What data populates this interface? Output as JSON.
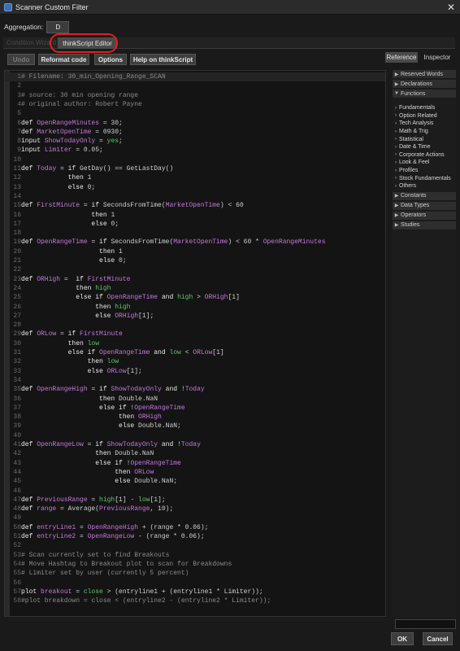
{
  "window": {
    "title": "Scanner Custom Filter",
    "close_glyph": "✕"
  },
  "aggregation": {
    "label": "Aggregation:",
    "value": "D"
  },
  "tabs": {
    "condition_wizard": "Condition Wizard",
    "thinkscript_editor": "thinkScript Editor"
  },
  "toolbar": {
    "undo": "Undo",
    "reformat": "Reformat code",
    "options": "Options",
    "help": "Help on thinkScript"
  },
  "side_tabs": {
    "reference": "Reference",
    "inspector": "Inspector"
  },
  "reference": {
    "sections_top": [
      {
        "label": "Reserved Words",
        "chev": "▶"
      },
      {
        "label": "Declarations",
        "chev": "▶"
      },
      {
        "label": "Functions",
        "chev": "▼"
      }
    ],
    "functions": [
      "Fundamentals",
      "Option Related",
      "Tech Analysis",
      "Math & Trig",
      "Statistical",
      "Date & Time",
      "Corporate Actions",
      "Look & Feel",
      "Profiles",
      "Stock Fundamentals",
      "Others"
    ],
    "sections_bottom": [
      "Constants",
      "Data Types",
      "Operators",
      "Studies"
    ]
  },
  "colors": {
    "keyword": "#e8e8e8",
    "identifier": "#c678dd",
    "number": "#d0d0d0",
    "comment": "#8a8a8a",
    "constant": "#5ec76a",
    "literal": "#5ec76a"
  },
  "code_lines": [
    [
      [
        "c",
        "# Filename: 30_min_Opening_Range_SCAN"
      ]
    ],
    [],
    [
      [
        "c",
        "# source: 30 min opening range"
      ]
    ],
    [
      [
        "c",
        "# original author: Robert Payne"
      ]
    ],
    [],
    [
      [
        "k",
        "def "
      ],
      [
        "v",
        "OpenRangeMinutes"
      ],
      [
        "p",
        " = 30;"
      ]
    ],
    [
      [
        "k",
        "def "
      ],
      [
        "v",
        "MarketOpenTime"
      ],
      [
        "p",
        " = 0930;"
      ]
    ],
    [
      [
        "k",
        "input "
      ],
      [
        "v",
        "ShowTodayOnly"
      ],
      [
        "p",
        " = "
      ],
      [
        "g",
        "yes"
      ],
      [
        "p",
        ";"
      ]
    ],
    [
      [
        "k",
        "input "
      ],
      [
        "v",
        "Limiter"
      ],
      [
        "p",
        " = 0.05;"
      ]
    ],
    [],
    [
      [
        "k",
        "def "
      ],
      [
        "v",
        "Today"
      ],
      [
        "p",
        " = "
      ],
      [
        "k",
        "if "
      ],
      [
        "p",
        "GetDay() == GetLastDay()"
      ]
    ],
    [
      [
        "p",
        "            "
      ],
      [
        "k",
        "then "
      ],
      [
        "p",
        "1"
      ]
    ],
    [
      [
        "p",
        "            "
      ],
      [
        "k",
        "else "
      ],
      [
        "p",
        "0;"
      ]
    ],
    [],
    [
      [
        "k",
        "def "
      ],
      [
        "v",
        "FirstMinute"
      ],
      [
        "p",
        " = "
      ],
      [
        "k",
        "if "
      ],
      [
        "p",
        "SecondsFromTime("
      ],
      [
        "v",
        "MarketOpenTime"
      ],
      [
        "p",
        ") < 60"
      ]
    ],
    [
      [
        "p",
        "                  "
      ],
      [
        "k",
        "then "
      ],
      [
        "p",
        "1"
      ]
    ],
    [
      [
        "p",
        "                  "
      ],
      [
        "k",
        "else "
      ],
      [
        "p",
        "0;"
      ]
    ],
    [],
    [
      [
        "k",
        "def "
      ],
      [
        "v",
        "OpenRangeTime"
      ],
      [
        "p",
        " = "
      ],
      [
        "k",
        "if "
      ],
      [
        "p",
        "SecondsFromTime("
      ],
      [
        "v",
        "MarketOpenTime"
      ],
      [
        "p",
        ") < 60 * "
      ],
      [
        "v",
        "OpenRangeMinutes"
      ]
    ],
    [
      [
        "p",
        "                    "
      ],
      [
        "k",
        "then "
      ],
      [
        "p",
        "1"
      ]
    ],
    [
      [
        "p",
        "                    "
      ],
      [
        "k",
        "else "
      ],
      [
        "p",
        "0;"
      ]
    ],
    [],
    [
      [
        "k",
        "def "
      ],
      [
        "v",
        "ORHigh"
      ],
      [
        "p",
        " =  "
      ],
      [
        "k",
        "if "
      ],
      [
        "v",
        "FirstMinute"
      ]
    ],
    [
      [
        "p",
        "              "
      ],
      [
        "k",
        "then "
      ],
      [
        "g",
        "high"
      ]
    ],
    [
      [
        "p",
        "              "
      ],
      [
        "k",
        "else if "
      ],
      [
        "v",
        "OpenRangeTime"
      ],
      [
        "k",
        " and "
      ],
      [
        "g",
        "high"
      ],
      [
        "p",
        " > "
      ],
      [
        "v",
        "ORHigh"
      ],
      [
        "p",
        "[1]"
      ]
    ],
    [
      [
        "p",
        "                   "
      ],
      [
        "k",
        "then "
      ],
      [
        "g",
        "high"
      ]
    ],
    [
      [
        "p",
        "                   "
      ],
      [
        "k",
        "else "
      ],
      [
        "v",
        "ORHigh"
      ],
      [
        "p",
        "[1];"
      ]
    ],
    [],
    [
      [
        "k",
        "def "
      ],
      [
        "v",
        "ORLow"
      ],
      [
        "p",
        " = "
      ],
      [
        "k",
        "if "
      ],
      [
        "v",
        "FirstMinute"
      ]
    ],
    [
      [
        "p",
        "            "
      ],
      [
        "k",
        "then "
      ],
      [
        "g",
        "low"
      ]
    ],
    [
      [
        "p",
        "            "
      ],
      [
        "k",
        "else if "
      ],
      [
        "v",
        "OpenRangeTime"
      ],
      [
        "k",
        " and "
      ],
      [
        "g",
        "low"
      ],
      [
        "p",
        " < "
      ],
      [
        "v",
        "ORLow"
      ],
      [
        "p",
        "[1]"
      ]
    ],
    [
      [
        "p",
        "                 "
      ],
      [
        "k",
        "then "
      ],
      [
        "g",
        "low"
      ]
    ],
    [
      [
        "p",
        "                 "
      ],
      [
        "k",
        "else "
      ],
      [
        "v",
        "ORLow"
      ],
      [
        "p",
        "[1];"
      ]
    ],
    [],
    [
      [
        "k",
        "def "
      ],
      [
        "v",
        "OpenRangeHigh"
      ],
      [
        "p",
        " = "
      ],
      [
        "k",
        "if "
      ],
      [
        "v",
        "ShowTodayOnly"
      ],
      [
        "k",
        " and "
      ],
      [
        "p",
        "!"
      ],
      [
        "v",
        "Today"
      ]
    ],
    [
      [
        "p",
        "                    "
      ],
      [
        "k",
        "then "
      ],
      [
        "p",
        "Double.NaN"
      ]
    ],
    [
      [
        "p",
        "                    "
      ],
      [
        "k",
        "else if "
      ],
      [
        "p",
        "!"
      ],
      [
        "v",
        "OpenRangeTime"
      ]
    ],
    [
      [
        "p",
        "                         "
      ],
      [
        "k",
        "then "
      ],
      [
        "v",
        "ORHigh"
      ]
    ],
    [
      [
        "p",
        "                         "
      ],
      [
        "k",
        "else "
      ],
      [
        "p",
        "Double.NaN;"
      ]
    ],
    [],
    [
      [
        "k",
        "def "
      ],
      [
        "v",
        "OpenRangeLow"
      ],
      [
        "p",
        " = "
      ],
      [
        "k",
        "if "
      ],
      [
        "v",
        "ShowTodayOnly"
      ],
      [
        "k",
        " and "
      ],
      [
        "p",
        "!"
      ],
      [
        "v",
        "Today"
      ]
    ],
    [
      [
        "p",
        "                   "
      ],
      [
        "k",
        "then "
      ],
      [
        "p",
        "Double.NaN"
      ]
    ],
    [
      [
        "p",
        "                   "
      ],
      [
        "k",
        "else if "
      ],
      [
        "p",
        "!"
      ],
      [
        "v",
        "OpenRangeTime"
      ]
    ],
    [
      [
        "p",
        "                        "
      ],
      [
        "k",
        "then "
      ],
      [
        "v",
        "ORLow"
      ]
    ],
    [
      [
        "p",
        "                        "
      ],
      [
        "k",
        "else "
      ],
      [
        "p",
        "Double.NaN;"
      ]
    ],
    [],
    [
      [
        "k",
        "def "
      ],
      [
        "v",
        "PreviousRange"
      ],
      [
        "p",
        " = "
      ],
      [
        "g",
        "high"
      ],
      [
        "p",
        "[1] - "
      ],
      [
        "g",
        "low"
      ],
      [
        "p",
        "[1];"
      ]
    ],
    [
      [
        "k",
        "def "
      ],
      [
        "v",
        "range"
      ],
      [
        "p",
        " = Average("
      ],
      [
        "v",
        "PreviousRange"
      ],
      [
        "p",
        ", 10);"
      ]
    ],
    [],
    [
      [
        "k",
        "def "
      ],
      [
        "v",
        "entryLine1"
      ],
      [
        "p",
        " = "
      ],
      [
        "v",
        "OpenRangeHigh"
      ],
      [
        "p",
        " + (range * 0.06);"
      ]
    ],
    [
      [
        "k",
        "def "
      ],
      [
        "v",
        "entryLine2"
      ],
      [
        "p",
        " = "
      ],
      [
        "v",
        "OpenRangeLow"
      ],
      [
        "p",
        " - (range * 0.06);"
      ]
    ],
    [],
    [
      [
        "c",
        "# Scan currently set to find Breakouts"
      ]
    ],
    [
      [
        "c",
        "# Move Hashtag to Breakout plot to scan for Breakdowns"
      ]
    ],
    [
      [
        "c",
        "# Limiter set by user (currently 5 percent)"
      ]
    ],
    [],
    [
      [
        "k",
        "plot "
      ],
      [
        "v",
        "breakout"
      ],
      [
        "p",
        " = "
      ],
      [
        "g",
        "close"
      ],
      [
        "p",
        " > (entryline1 + (entryline1 * Limiter));"
      ]
    ],
    [
      [
        "c",
        "#plot breakdown = close < (entryline2 - (entryline2 * Limiter));"
      ]
    ]
  ],
  "footer": {
    "ok": "OK",
    "cancel": "Cancel"
  }
}
